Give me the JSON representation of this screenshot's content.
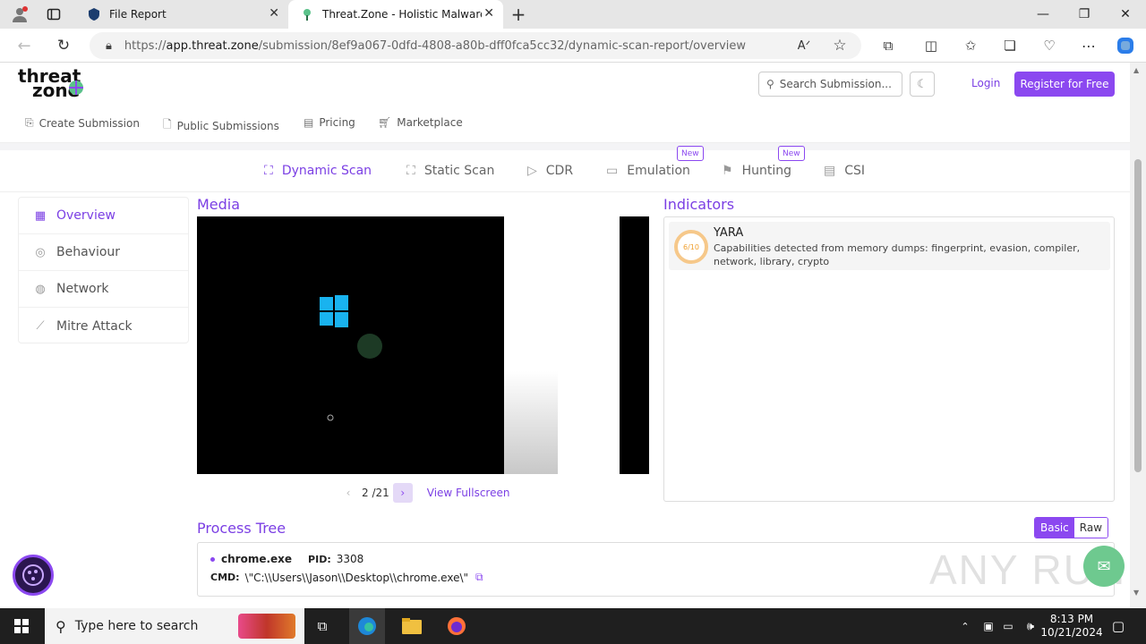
{
  "browser": {
    "tabs": [
      {
        "title": "File Report"
      },
      {
        "title": "Threat.Zone - Holistic Malware A"
      }
    ],
    "url": {
      "prefix": "https://",
      "host": "app.threat.zone",
      "path": "/submission/8ef9a067-0dfd-4808-a80b-dff0fca5cc32/dynamic-scan-report/overview"
    }
  },
  "header": {
    "logo_line1": "threat",
    "logo_line2": "zone",
    "search_placeholder": "Search Submission...",
    "login": "Login",
    "register": "Register for Free",
    "nav": [
      "Create Submission",
      "Public Submissions",
      "Pricing",
      "Marketplace"
    ]
  },
  "scan_tabs": [
    {
      "label": "Dynamic Scan",
      "active": true
    },
    {
      "label": "Static Scan"
    },
    {
      "label": "CDR"
    },
    {
      "label": "Emulation",
      "badge": "New"
    },
    {
      "label": "Hunting",
      "badge": "New"
    },
    {
      "label": "CSI"
    }
  ],
  "sidebar": {
    "items": [
      {
        "label": "Overview",
        "active": true
      },
      {
        "label": "Behaviour"
      },
      {
        "label": "Network"
      },
      {
        "label": "Mitre Attack"
      }
    ]
  },
  "media": {
    "title": "Media",
    "page": "2 /21",
    "view_fullscreen": "View Fullscreen"
  },
  "indicators": {
    "title": "Indicators",
    "items": [
      {
        "score": "6/10",
        "name": "YARA",
        "description": "Capabilities detected from memory dumps: fingerprint, evasion, compiler, network, library, crypto"
      }
    ]
  },
  "process_tree": {
    "title": "Process Tree",
    "toggle": [
      "Basic",
      "Raw"
    ],
    "process": {
      "name": "chrome.exe",
      "pid_label": "PID:",
      "pid": "3308",
      "cmd_label": "CMD:",
      "cmd": "\\\"C:\\\\Users\\\\Jason\\\\Desktop\\\\chrome.exe\\\""
    }
  },
  "watermark": "ANY RUN",
  "taskbar": {
    "search_placeholder": "Type here to search",
    "time": "8:13 PM",
    "date": "10/21/2024"
  },
  "colors": {
    "accent": "#8b48f0",
    "accent_text": "#7b3fe4",
    "taskbar": "#1f1f1f"
  }
}
